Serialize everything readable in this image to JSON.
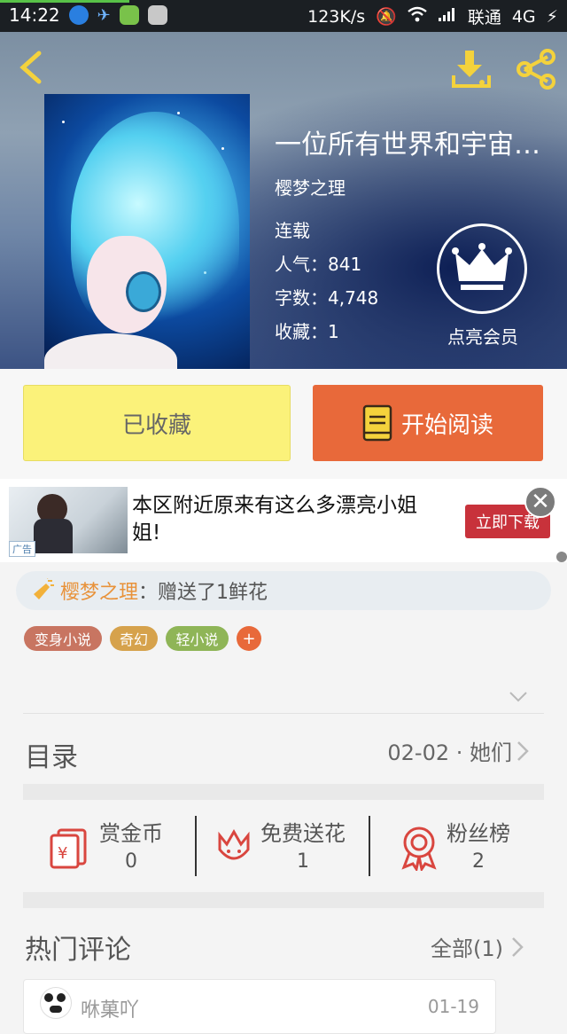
{
  "status_bar": {
    "time": "14:22",
    "network_speed": "123K/s",
    "carrier": "联通",
    "network_type": "4G"
  },
  "book": {
    "title": "一位所有世界和宇宙…",
    "author": "樱梦之理",
    "status": "连载",
    "popularity_label": "人气：",
    "popularity_value": "841",
    "wordcount_label": "字数：",
    "wordcount_value": "4,748",
    "favorites_label": "收藏：",
    "favorites_value": "1"
  },
  "vip": {
    "label": "点亮会员"
  },
  "actions": {
    "favorited_label": "已收藏",
    "start_reading_label": "开始阅读"
  },
  "ad": {
    "tag": "广告",
    "text": "本区附近原来有这么多漂亮小姐姐!",
    "button": "立即下载"
  },
  "notice": {
    "user": "樱梦之理",
    "text": "：赠送了1鲜花"
  },
  "tags": [
    {
      "label": "变身小说",
      "color": "#c87561"
    },
    {
      "label": "奇幻",
      "color": "#d6a24c"
    },
    {
      "label": "轻小说",
      "color": "#8fb557"
    }
  ],
  "add_tag_label": "+",
  "toc": {
    "label": "目录",
    "latest": "02-02 · 她们"
  },
  "rewards": [
    {
      "label": "赏金币",
      "value": "0",
      "icon": "red-envelope-icon"
    },
    {
      "label": "免费送花",
      "value": "1",
      "icon": "flower-icon"
    },
    {
      "label": "粉丝榜",
      "value": "2",
      "icon": "medal-icon"
    }
  ],
  "comments": {
    "header": "热门评论",
    "all_label": "全部(1)",
    "first": {
      "user": "咻菓吖",
      "date": "01-19"
    }
  },
  "colors": {
    "accent_orange": "#e8693a",
    "fav_yellow": "#fbf27a",
    "icon_yellow": "#f4d23c",
    "reward_red": "#d9463f"
  }
}
